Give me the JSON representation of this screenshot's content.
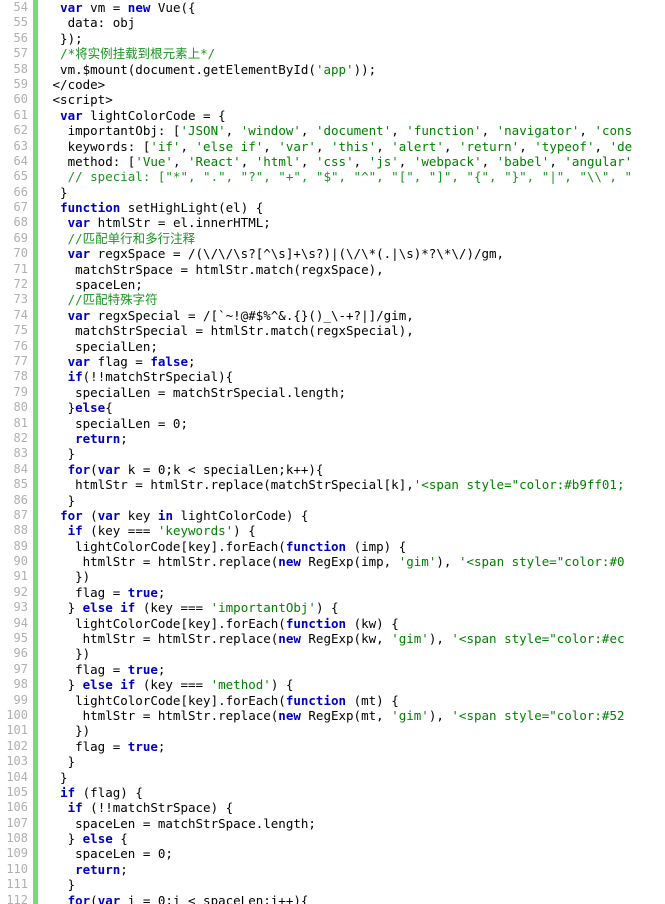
{
  "editor": {
    "name": "code-editor",
    "language": "javascript-html",
    "first_line_number": 54,
    "last_line_number": 112,
    "colors": {
      "background": "#ffffff",
      "gutter_text": "#b0b0b0",
      "gutter_marker_bar": "#6fdc74",
      "keyword": "#0000c0",
      "string": "#008000",
      "comment": "#1a9622",
      "plain": "#000000"
    },
    "lines": [
      {
        "n": 54,
        "tokens": [
          {
            "t": "plain",
            "v": "  "
          },
          {
            "t": "kw",
            "v": "var"
          },
          {
            "t": "plain",
            "v": " vm = "
          },
          {
            "t": "kw",
            "v": "new"
          },
          {
            "t": "plain",
            "v": " Vue({"
          }
        ]
      },
      {
        "n": 55,
        "tokens": [
          {
            "t": "plain",
            "v": "   data: obj"
          }
        ]
      },
      {
        "n": 56,
        "tokens": [
          {
            "t": "plain",
            "v": "  });"
          }
        ]
      },
      {
        "n": 57,
        "tokens": [
          {
            "t": "plain",
            "v": "  "
          },
          {
            "t": "cmt",
            "v": "/*将实例挂载到根元素上*/"
          }
        ]
      },
      {
        "n": 58,
        "tokens": [
          {
            "t": "plain",
            "v": "  vm.$mount(document.getElementById("
          },
          {
            "t": "str",
            "v": "'app'"
          },
          {
            "t": "plain",
            "v": "));"
          }
        ]
      },
      {
        "n": 59,
        "tokens": [
          {
            "t": "plain",
            "v": " </code>"
          }
        ]
      },
      {
        "n": 60,
        "tokens": [
          {
            "t": "plain",
            "v": " <script>"
          }
        ]
      },
      {
        "n": 61,
        "tokens": [
          {
            "t": "plain",
            "v": "  "
          },
          {
            "t": "kw",
            "v": "var"
          },
          {
            "t": "plain",
            "v": " lightColorCode = {"
          }
        ]
      },
      {
        "n": 62,
        "tokens": [
          {
            "t": "plain",
            "v": "   importantObj: ["
          },
          {
            "t": "str",
            "v": "'JSON'"
          },
          {
            "t": "plain",
            "v": ", "
          },
          {
            "t": "str",
            "v": "'window'"
          },
          {
            "t": "plain",
            "v": ", "
          },
          {
            "t": "str",
            "v": "'document'"
          },
          {
            "t": "plain",
            "v": ", "
          },
          {
            "t": "str",
            "v": "'function'"
          },
          {
            "t": "plain",
            "v": ", "
          },
          {
            "t": "str",
            "v": "'navigator'"
          },
          {
            "t": "plain",
            "v": ", "
          },
          {
            "t": "str",
            "v": "'cons"
          }
        ]
      },
      {
        "n": 63,
        "tokens": [
          {
            "t": "plain",
            "v": "   keywords: ["
          },
          {
            "t": "str",
            "v": "'if'"
          },
          {
            "t": "plain",
            "v": ", "
          },
          {
            "t": "str",
            "v": "'else if'"
          },
          {
            "t": "plain",
            "v": ", "
          },
          {
            "t": "str",
            "v": "'var'"
          },
          {
            "t": "plain",
            "v": ", "
          },
          {
            "t": "str",
            "v": "'this'"
          },
          {
            "t": "plain",
            "v": ", "
          },
          {
            "t": "str",
            "v": "'alert'"
          },
          {
            "t": "plain",
            "v": ", "
          },
          {
            "t": "str",
            "v": "'return'"
          },
          {
            "t": "plain",
            "v": ", "
          },
          {
            "t": "str",
            "v": "'typeof'"
          },
          {
            "t": "plain",
            "v": ", "
          },
          {
            "t": "str",
            "v": "'de"
          }
        ]
      },
      {
        "n": 64,
        "tokens": [
          {
            "t": "plain",
            "v": "   method: ["
          },
          {
            "t": "str",
            "v": "'Vue'"
          },
          {
            "t": "plain",
            "v": ", "
          },
          {
            "t": "str",
            "v": "'React'"
          },
          {
            "t": "plain",
            "v": ", "
          },
          {
            "t": "str",
            "v": "'html'"
          },
          {
            "t": "plain",
            "v": ", "
          },
          {
            "t": "str",
            "v": "'css'"
          },
          {
            "t": "plain",
            "v": ", "
          },
          {
            "t": "str",
            "v": "'js'"
          },
          {
            "t": "plain",
            "v": ", "
          },
          {
            "t": "str",
            "v": "'webpack'"
          },
          {
            "t": "plain",
            "v": ", "
          },
          {
            "t": "str",
            "v": "'babel'"
          },
          {
            "t": "plain",
            "v": ", "
          },
          {
            "t": "str",
            "v": "'angular'"
          }
        ]
      },
      {
        "n": 65,
        "tokens": [
          {
            "t": "plain",
            "v": "   "
          },
          {
            "t": "cmt",
            "v": "// special: [\"*\", \".\", \"?\", \"+\", \"$\", \"^\", \"[\", \"]\", \"{\", \"}\", \"|\", \"\\\\\", \""
          }
        ]
      },
      {
        "n": 66,
        "tokens": [
          {
            "t": "plain",
            "v": "  }"
          }
        ]
      },
      {
        "n": 67,
        "tokens": [
          {
            "t": "plain",
            "v": "  "
          },
          {
            "t": "kw",
            "v": "function"
          },
          {
            "t": "plain",
            "v": " setHighLight(el) {"
          }
        ]
      },
      {
        "n": 68,
        "tokens": [
          {
            "t": "plain",
            "v": "   "
          },
          {
            "t": "kw",
            "v": "var"
          },
          {
            "t": "plain",
            "v": " htmlStr = el.innerHTML;"
          }
        ]
      },
      {
        "n": 69,
        "tokens": [
          {
            "t": "plain",
            "v": "   "
          },
          {
            "t": "cmt",
            "v": "//匹配单行和多行注释"
          }
        ]
      },
      {
        "n": 70,
        "tokens": [
          {
            "t": "plain",
            "v": "   "
          },
          {
            "t": "kw",
            "v": "var"
          },
          {
            "t": "plain",
            "v": " regxSpace = /(\\/\\/\\s?[^\\s]+\\s?)|(\\/\\*(.|\\s)*?\\*\\/)/gm,"
          }
        ]
      },
      {
        "n": 71,
        "tokens": [
          {
            "t": "plain",
            "v": "    matchStrSpace = htmlStr.match(regxSpace),"
          }
        ]
      },
      {
        "n": 72,
        "tokens": [
          {
            "t": "plain",
            "v": "    spaceLen;"
          }
        ]
      },
      {
        "n": 73,
        "tokens": [
          {
            "t": "plain",
            "v": "   "
          },
          {
            "t": "cmt",
            "v": "//匹配特殊字符"
          }
        ]
      },
      {
        "n": 74,
        "tokens": [
          {
            "t": "plain",
            "v": "   "
          },
          {
            "t": "kw",
            "v": "var"
          },
          {
            "t": "plain",
            "v": " regxSpecial = /[`~!@#$%^&.{}()_\\-+?|]/gim,"
          }
        ]
      },
      {
        "n": 75,
        "tokens": [
          {
            "t": "plain",
            "v": "    matchStrSpecial = htmlStr.match(regxSpecial),"
          }
        ]
      },
      {
        "n": 76,
        "tokens": [
          {
            "t": "plain",
            "v": "    specialLen;"
          }
        ]
      },
      {
        "n": 77,
        "tokens": [
          {
            "t": "plain",
            "v": "   "
          },
          {
            "t": "kw",
            "v": "var"
          },
          {
            "t": "plain",
            "v": " flag = "
          },
          {
            "t": "kw",
            "v": "false"
          },
          {
            "t": "plain",
            "v": ";"
          }
        ]
      },
      {
        "n": 78,
        "tokens": [
          {
            "t": "plain",
            "v": "   "
          },
          {
            "t": "kw",
            "v": "if"
          },
          {
            "t": "plain",
            "v": "(!!matchStrSpecial){"
          }
        ]
      },
      {
        "n": 79,
        "tokens": [
          {
            "t": "plain",
            "v": "    specialLen = matchStrSpecial.length;"
          }
        ]
      },
      {
        "n": 80,
        "tokens": [
          {
            "t": "plain",
            "v": "   }"
          },
          {
            "t": "kw",
            "v": "else"
          },
          {
            "t": "plain",
            "v": "{"
          }
        ]
      },
      {
        "n": 81,
        "tokens": [
          {
            "t": "plain",
            "v": "    specialLen = 0;"
          }
        ]
      },
      {
        "n": 82,
        "tokens": [
          {
            "t": "plain",
            "v": "    "
          },
          {
            "t": "kw",
            "v": "return"
          },
          {
            "t": "plain",
            "v": ";"
          }
        ]
      },
      {
        "n": 83,
        "tokens": [
          {
            "t": "plain",
            "v": "   }"
          }
        ]
      },
      {
        "n": 84,
        "tokens": [
          {
            "t": "plain",
            "v": "   "
          },
          {
            "t": "kw",
            "v": "for"
          },
          {
            "t": "plain",
            "v": "("
          },
          {
            "t": "kw",
            "v": "var"
          },
          {
            "t": "plain",
            "v": " k = 0;k < specialLen;k++){"
          }
        ]
      },
      {
        "n": 85,
        "tokens": [
          {
            "t": "plain",
            "v": "    htmlStr = htmlStr.replace(matchStrSpecial[k],"
          },
          {
            "t": "str",
            "v": "'<span style=\"color:#b9ff01;"
          }
        ]
      },
      {
        "n": 86,
        "tokens": [
          {
            "t": "plain",
            "v": "   }"
          }
        ]
      },
      {
        "n": 87,
        "tokens": [
          {
            "t": "plain",
            "v": "  "
          },
          {
            "t": "kw",
            "v": "for"
          },
          {
            "t": "plain",
            "v": " ("
          },
          {
            "t": "kw",
            "v": "var"
          },
          {
            "t": "plain",
            "v": " key "
          },
          {
            "t": "kw",
            "v": "in"
          },
          {
            "t": "plain",
            "v": " lightColorCode) {"
          }
        ]
      },
      {
        "n": 88,
        "tokens": [
          {
            "t": "plain",
            "v": "   "
          },
          {
            "t": "kw",
            "v": "if"
          },
          {
            "t": "plain",
            "v": " (key === "
          },
          {
            "t": "str",
            "v": "'keywords'"
          },
          {
            "t": "plain",
            "v": ") {"
          }
        ]
      },
      {
        "n": 89,
        "tokens": [
          {
            "t": "plain",
            "v": "    lightColorCode[key].forEach("
          },
          {
            "t": "kw",
            "v": "function"
          },
          {
            "t": "plain",
            "v": " (imp) {"
          }
        ]
      },
      {
        "n": 90,
        "tokens": [
          {
            "t": "plain",
            "v": "     htmlStr = htmlStr.replace("
          },
          {
            "t": "kw",
            "v": "new"
          },
          {
            "t": "plain",
            "v": " RegExp(imp, "
          },
          {
            "t": "str",
            "v": "'gim'"
          },
          {
            "t": "plain",
            "v": "), "
          },
          {
            "t": "str",
            "v": "'<span style=\"color:#0"
          }
        ]
      },
      {
        "n": 91,
        "tokens": [
          {
            "t": "plain",
            "v": "    })"
          }
        ]
      },
      {
        "n": 92,
        "tokens": [
          {
            "t": "plain",
            "v": "    flag = "
          },
          {
            "t": "kw",
            "v": "true"
          },
          {
            "t": "plain",
            "v": ";"
          }
        ]
      },
      {
        "n": 93,
        "tokens": [
          {
            "t": "plain",
            "v": "   } "
          },
          {
            "t": "kw",
            "v": "else if"
          },
          {
            "t": "plain",
            "v": " (key === "
          },
          {
            "t": "str",
            "v": "'importantObj'"
          },
          {
            "t": "plain",
            "v": ") {"
          }
        ]
      },
      {
        "n": 94,
        "tokens": [
          {
            "t": "plain",
            "v": "    lightColorCode[key].forEach("
          },
          {
            "t": "kw",
            "v": "function"
          },
          {
            "t": "plain",
            "v": " (kw) {"
          }
        ]
      },
      {
        "n": 95,
        "tokens": [
          {
            "t": "plain",
            "v": "     htmlStr = htmlStr.replace("
          },
          {
            "t": "kw",
            "v": "new"
          },
          {
            "t": "plain",
            "v": " RegExp(kw, "
          },
          {
            "t": "str",
            "v": "'gim'"
          },
          {
            "t": "plain",
            "v": "), "
          },
          {
            "t": "str",
            "v": "'<span style=\"color:#ec"
          }
        ]
      },
      {
        "n": 96,
        "tokens": [
          {
            "t": "plain",
            "v": "    })"
          }
        ]
      },
      {
        "n": 97,
        "tokens": [
          {
            "t": "plain",
            "v": "    flag = "
          },
          {
            "t": "kw",
            "v": "true"
          },
          {
            "t": "plain",
            "v": ";"
          }
        ]
      },
      {
        "n": 98,
        "tokens": [
          {
            "t": "plain",
            "v": "   } "
          },
          {
            "t": "kw",
            "v": "else if"
          },
          {
            "t": "plain",
            "v": " (key === "
          },
          {
            "t": "str",
            "v": "'method'"
          },
          {
            "t": "plain",
            "v": ") {"
          }
        ]
      },
      {
        "n": 99,
        "tokens": [
          {
            "t": "plain",
            "v": "    lightColorCode[key].forEach("
          },
          {
            "t": "kw",
            "v": "function"
          },
          {
            "t": "plain",
            "v": " (mt) {"
          }
        ]
      },
      {
        "n": 100,
        "tokens": [
          {
            "t": "plain",
            "v": "     htmlStr = htmlStr.replace("
          },
          {
            "t": "kw",
            "v": "new"
          },
          {
            "t": "plain",
            "v": " RegExp(mt, "
          },
          {
            "t": "str",
            "v": "'gim'"
          },
          {
            "t": "plain",
            "v": "), "
          },
          {
            "t": "str",
            "v": "'<span style=\"color:#52"
          }
        ]
      },
      {
        "n": 101,
        "tokens": [
          {
            "t": "plain",
            "v": "    })"
          }
        ]
      },
      {
        "n": 102,
        "tokens": [
          {
            "t": "plain",
            "v": "    flag = "
          },
          {
            "t": "kw",
            "v": "true"
          },
          {
            "t": "plain",
            "v": ";"
          }
        ]
      },
      {
        "n": 103,
        "tokens": [
          {
            "t": "plain",
            "v": "   }"
          }
        ]
      },
      {
        "n": 104,
        "tokens": [
          {
            "t": "plain",
            "v": "  }"
          }
        ]
      },
      {
        "n": 105,
        "tokens": [
          {
            "t": "plain",
            "v": "  "
          },
          {
            "t": "kw",
            "v": "if"
          },
          {
            "t": "plain",
            "v": " (flag) {"
          }
        ]
      },
      {
        "n": 106,
        "tokens": [
          {
            "t": "plain",
            "v": "   "
          },
          {
            "t": "kw",
            "v": "if"
          },
          {
            "t": "plain",
            "v": " (!!matchStrSpace) {"
          }
        ]
      },
      {
        "n": 107,
        "tokens": [
          {
            "t": "plain",
            "v": "    spaceLen = matchStrSpace.length;"
          }
        ]
      },
      {
        "n": 108,
        "tokens": [
          {
            "t": "plain",
            "v": "   } "
          },
          {
            "t": "kw",
            "v": "else"
          },
          {
            "t": "plain",
            "v": " {"
          }
        ]
      },
      {
        "n": 109,
        "tokens": [
          {
            "t": "plain",
            "v": "    spaceLen = 0;"
          }
        ]
      },
      {
        "n": 110,
        "tokens": [
          {
            "t": "plain",
            "v": "    "
          },
          {
            "t": "kw",
            "v": "return"
          },
          {
            "t": "plain",
            "v": ";"
          }
        ]
      },
      {
        "n": 111,
        "tokens": [
          {
            "t": "plain",
            "v": "   }"
          }
        ]
      },
      {
        "n": 112,
        "tokens": [
          {
            "t": "plain",
            "v": "   "
          },
          {
            "t": "kw",
            "v": "for"
          },
          {
            "t": "plain",
            "v": "("
          },
          {
            "t": "kw",
            "v": "var"
          },
          {
            "t": "plain",
            "v": " i = 0;i < spaceLen;i++){"
          }
        ]
      }
    ]
  }
}
